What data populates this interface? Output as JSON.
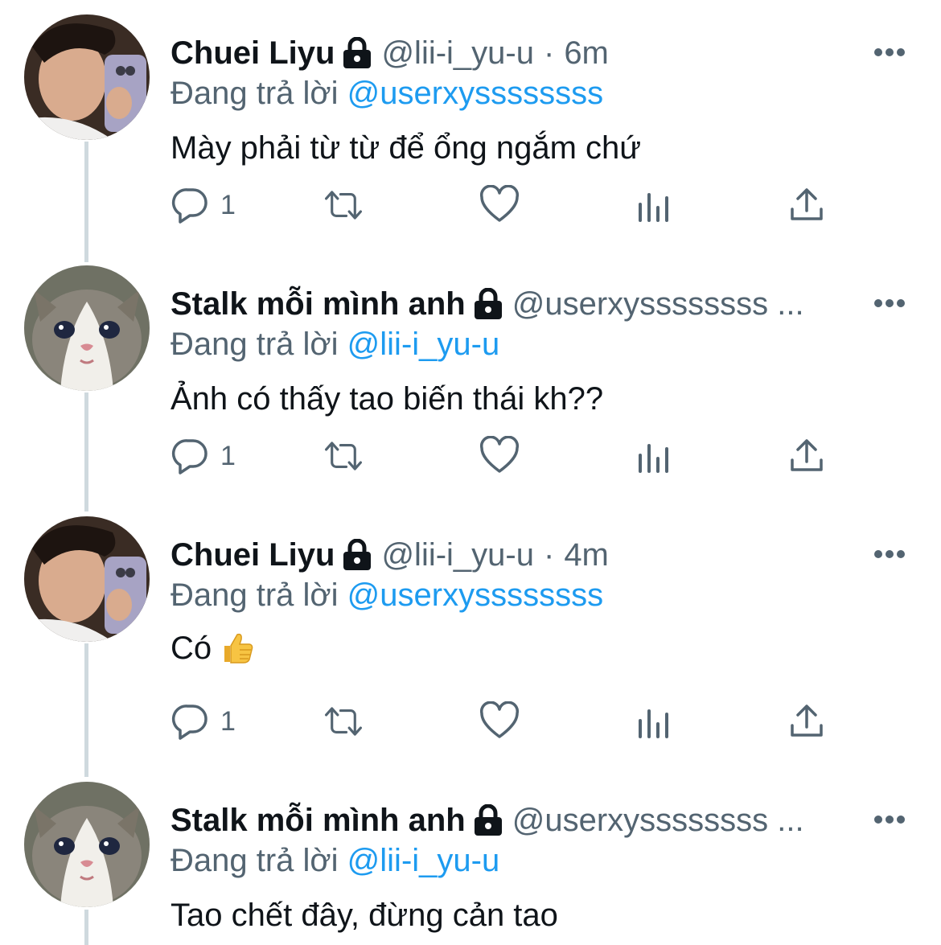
{
  "tweets": [
    {
      "name": "Chuei Liyu",
      "handle": "@lii-i_yu-u",
      "separator": "·",
      "time": "6m",
      "reply_prefix": "Đang trả lời",
      "reply_to": "@userxyssssssss",
      "text": "Mày phải từ từ để ổng ngắm chứ",
      "reply_count": "1",
      "avatar": "person-avatar"
    },
    {
      "name": "Stalk mỗi mình anh",
      "handle": "@userxyssssssss ...",
      "separator": "",
      "time": "",
      "reply_prefix": "Đang trả lời",
      "reply_to": "@lii-i_yu-u",
      "text": "Ảnh có thấy tao biến thái kh??",
      "reply_count": "1",
      "avatar": "cat-avatar"
    },
    {
      "name": "Chuei Liyu",
      "handle": "@lii-i_yu-u",
      "separator": "·",
      "time": "4m",
      "reply_prefix": "Đang trả lời",
      "reply_to": "@userxyssssssss",
      "text": "Có",
      "emoji": "thumbs-up",
      "reply_count": "1",
      "avatar": "person-avatar"
    },
    {
      "name": "Stalk mỗi mình anh",
      "handle": "@userxyssssssss ...",
      "separator": "",
      "time": "",
      "reply_prefix": "Đang trả lời",
      "reply_to": "@lii-i_yu-u",
      "text": "Tao chết đây, đừng cản tao",
      "avatar": "cat-avatar"
    }
  ],
  "icons": {
    "reply": "reply-icon",
    "retweet": "retweet-icon",
    "like": "heart-icon",
    "analytics": "analytics-icon",
    "share": "share-icon",
    "lock": "lock-icon",
    "more": "more-icon"
  },
  "colors": {
    "text": "#0f1419",
    "secondary": "#536471",
    "link": "#1d9bf0",
    "thread_line": "#cfd9de"
  }
}
